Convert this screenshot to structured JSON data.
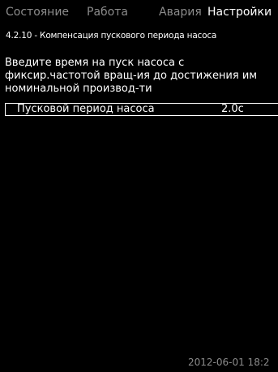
{
  "tabs": [
    {
      "label": "Состояние",
      "active": false
    },
    {
      "label": "Работа",
      "active": false
    },
    {
      "label": "Авария",
      "active": false
    },
    {
      "label": "Настройки",
      "active": true
    }
  ],
  "menu": {
    "title": "4.2.10 - Компенсация пускового периода насоса"
  },
  "description": {
    "lines": [
      "Введите время на пуск насоса с",
      "фиксир.частотой вращ-ия до достижения им",
      "номинальной производ-ти"
    ]
  },
  "parameter": {
    "label": "Пусковой период насоса",
    "value": "2.0с"
  },
  "status_bar": {
    "datetime": "2012-06-01 18:2"
  },
  "colors": {
    "background": "#000000",
    "text": "#ffffff",
    "inactive_tab": "#8c8c8c"
  }
}
